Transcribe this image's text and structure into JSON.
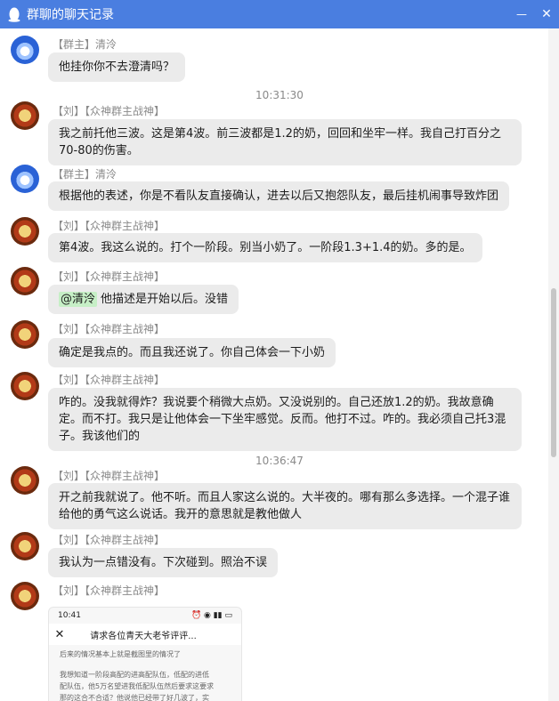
{
  "window": {
    "title": "群聊的聊天记录",
    "minimize": "—",
    "close": "✕"
  },
  "messages": [
    {
      "sender": "【群主】清泠",
      "text": "他挂你你不去澄清吗？"
    },
    {
      "time": "10:31:30"
    },
    {
      "sender": "【刘】【众神群主战神】",
      "text": "我之前托他三波。这是第4波。前三波都是1.2的奶，回回和坐牢一样。我自己打百分之70-80的伤害。"
    },
    {
      "sender": "【群主】清泠",
      "text": "根据他的表述，你是不看队友直接确认，进去以后又抱怨队友，最后挂机闹事导致炸团"
    },
    {
      "sender": "【刘】【众神群主战神】",
      "text": "第4波。我这么说的。打个一阶段。别当小奶了。一阶段1.3+1.4的奶。多的是。"
    },
    {
      "sender": "【刘】【众神群主战神】",
      "mention": "@清泠",
      "text": "他描述是开始以后。没错"
    },
    {
      "sender": "【刘】【众神群主战神】",
      "text": "确定是我点的。而且我还说了。你自己体会一下小奶"
    },
    {
      "sender": "【刘】【众神群主战神】",
      "text": "咋的。没我就得炸？我说要个稍微大点奶。又没说别的。自己还放1.2的奶。我故意确定。而不打。我只是让他体会一下坐牢感觉。反而。他打不过。咋的。我必须自己托3混子。我该他们的"
    },
    {
      "time": "10:36:47"
    },
    {
      "sender": "【刘】【众神群主战神】",
      "text": "开之前我就说了。他不听。而且人家这么说的。大半夜的。哪有那么多选择。一个混子谁给他的勇气这么说话。我开的意思就是教他做人"
    },
    {
      "sender": "【刘】【众神群主战神】",
      "text": "我认为一点错没有。下次碰到。照治不误"
    },
    {
      "sender": "【刘】【众神群主战神】"
    }
  ],
  "screenshot": {
    "clock": "10:41",
    "status_icons": "⏰ ◉ ▮▮ ▭",
    "close": "✕",
    "title": "请求各位青天大老爷评评...",
    "lines": [
      "后来的情况基本上就是截图里的情况了",
      "我想知道一阶段高配的进高配队伍，低配的进低",
      "配队伍，他5万名望进我低配队伍然后要求这要求",
      "那的这合不合适？他说他已经带了好几波了，实"
    ]
  }
}
